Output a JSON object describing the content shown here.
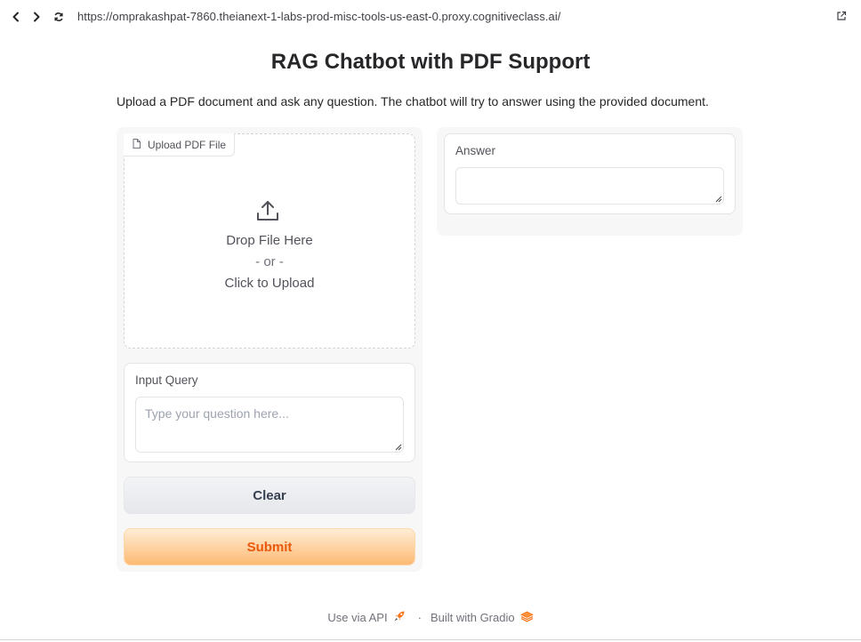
{
  "browser": {
    "url": "https://omprakashpat-7860.theianext-1-labs-prod-misc-tools-us-east-0.proxy.cognitiveclass.ai/",
    "icons": [
      "back-icon",
      "forward-icon",
      "reload-icon",
      "external-link-icon"
    ]
  },
  "page": {
    "title": "RAG Chatbot with PDF Support",
    "description": "Upload a PDF document and ask any question. The chatbot will try to answer using the provided document."
  },
  "upload": {
    "label": "Upload PDF File",
    "drop_text": "Drop File Here",
    "or_text": "- or -",
    "click_text": "Click to Upload"
  },
  "query": {
    "label": "Input Query",
    "placeholder": "Type your question here...",
    "value": ""
  },
  "answer": {
    "label": "Answer",
    "value": ""
  },
  "buttons": {
    "clear": "Clear",
    "submit": "Submit"
  },
  "footer": {
    "api_link": "Use via API",
    "separator": "·",
    "built_with": "Built with Gradio"
  },
  "colors": {
    "submit_text": "#ea580c",
    "submit_bg": "#fdba74",
    "clear_bg": "#e5e7eb",
    "panel_bg": "#f7f7f8"
  }
}
